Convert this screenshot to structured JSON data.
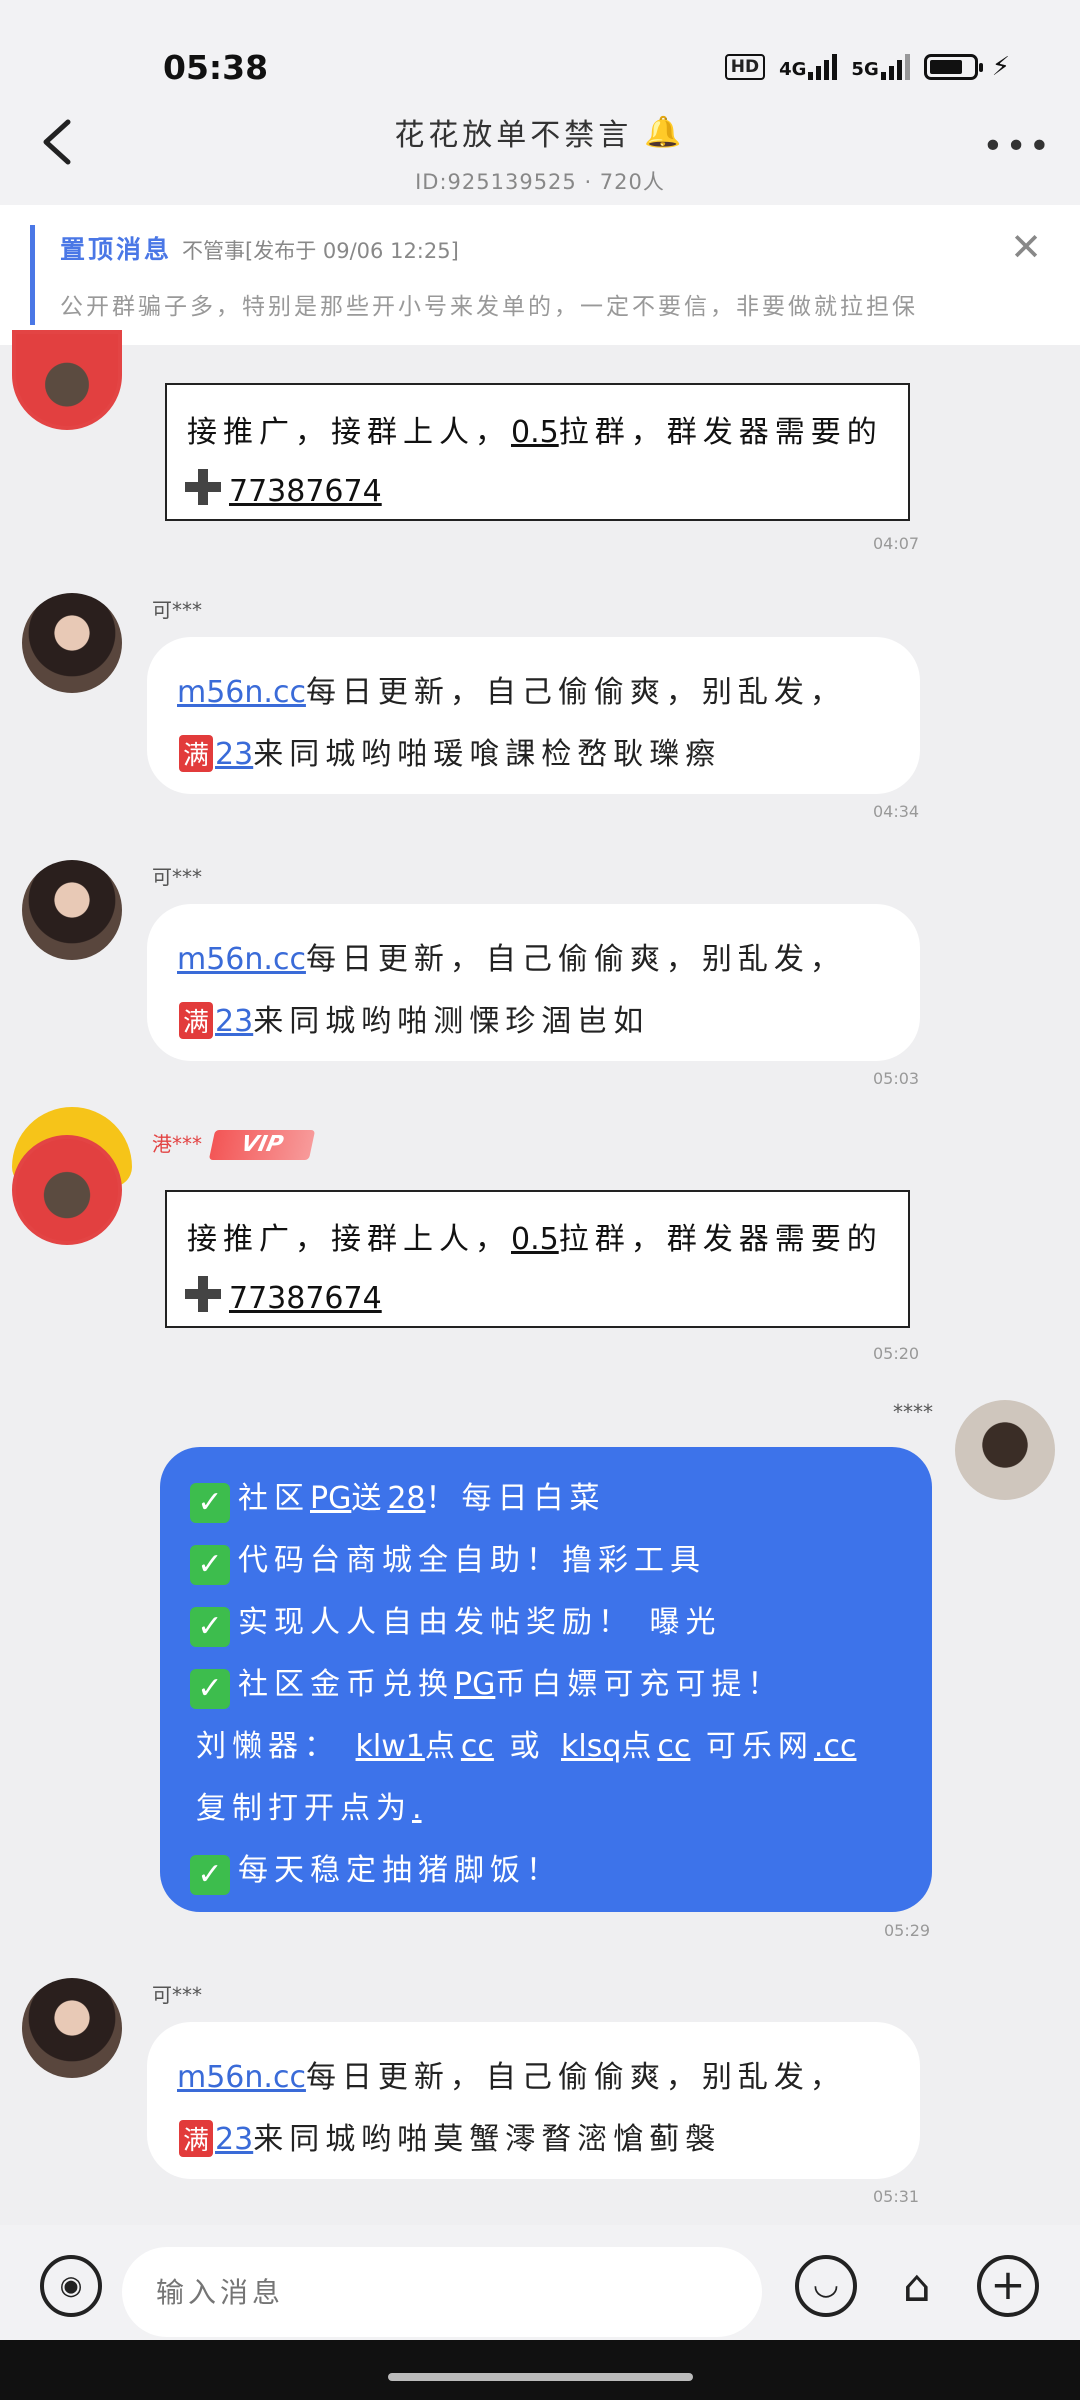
{
  "status_bar": {
    "time": "05:38",
    "hd": "HD",
    "net1": "4G",
    "net2": "5G"
  },
  "header": {
    "title": "花花放单不禁言",
    "subtitle": "ID:925139525 · 720人"
  },
  "pinned": {
    "label": "置顶消息",
    "meta": "不管事[发布于 09/06 12:25]",
    "text": "公开群骗子多，特别是那些开小号来发单的，一定不要信，非要做就拉担保"
  },
  "promo": {
    "line1_a": "接推广，接群上人，",
    "line1_b": "0.5",
    "line1_c": "拉群，群发器需要的",
    "line2": "77387674"
  },
  "messages": [
    {
      "nick": "可***",
      "link": "m56n.cc",
      "line1": "每日更新，自己偷偷爽，别乱发，",
      "badge": "满",
      "num": "23",
      "line2": "来同城哟啪瑗喰課检嵍耿瓅瘵",
      "time": "04:34"
    },
    {
      "nick": "可***",
      "link": "m56n.cc",
      "line1": "每日更新，自己偷偷爽，别乱发，",
      "badge": "满",
      "num": "23",
      "line2": "来同城哟啪测慄珍涸岜如",
      "time": "05:03"
    },
    {
      "nick": "可***",
      "link": "m56n.cc",
      "line1": "每日更新，自己偷偷爽，别乱发，",
      "badge": "满",
      "num": "23",
      "line2": "来同城哟啪莫蟹澪瞀滵愴蓟褩",
      "time": "05:31"
    }
  ],
  "promo_times": {
    "first": "04:07",
    "second": "05:20"
  },
  "vip_nick": "港***",
  "vip_badge": "VIP",
  "self": {
    "nick": "****",
    "time": "05:29",
    "lines": [
      {
        "pre": "社区",
        "u": "PG",
        "mid": "送",
        "u2": "28",
        "post": "！每日白菜"
      },
      {
        "pre": "代码台商城全自助！撸彩工具"
      },
      {
        "pre": "实现人人自由发帖奖励！ 曝光"
      },
      {
        "pre": "社区金币兑换",
        "u": "PG",
        "post": "币白嫖可充可提！"
      }
    ],
    "line5_a": "刘懒器：",
    "line5_b": "klw1",
    "line5_c": "点",
    "line5_d": "cc",
    "line5_e": "或",
    "line5_f": "klsq",
    "line5_g": "点",
    "line5_h": "cc",
    "line5_i": "可乐网",
    "line5_j": ".cc",
    "line6": "复制打开点为",
    "line6_dot": ".",
    "line7": "每天稳定抽猪脚饭！"
  },
  "input": {
    "placeholder": "输入消息"
  }
}
